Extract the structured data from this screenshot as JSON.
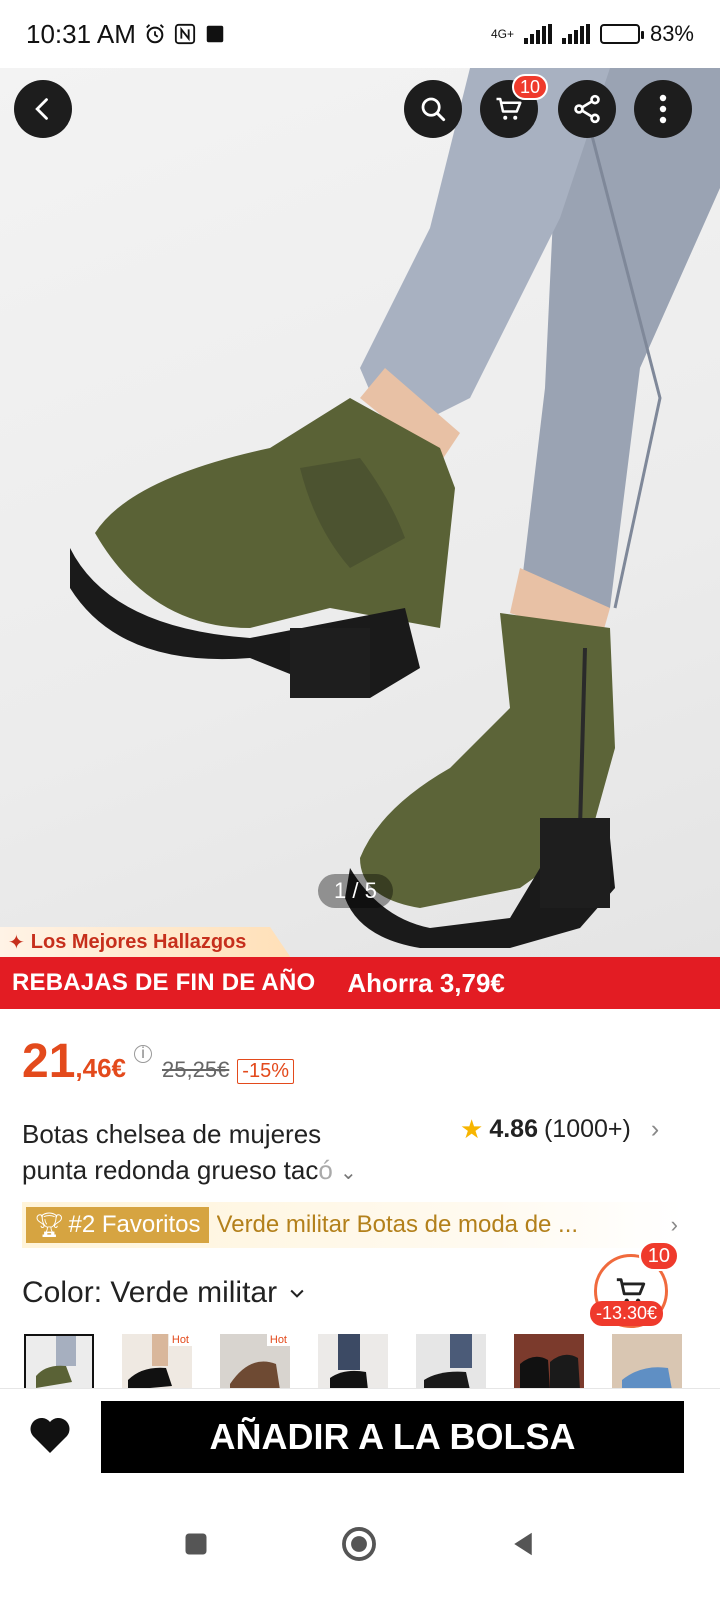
{
  "status_bar": {
    "time": "10:31 AM",
    "network": "4G+",
    "battery": "83%"
  },
  "header": {
    "cart_count": "10"
  },
  "gallery": {
    "page_indicator": "1 / 5"
  },
  "promo": {
    "top_label": "Los Mejores Hallazgos",
    "sale_label": "REBAJAS DE FIN DE AÑO",
    "savings_label": "Ahorra 3,79€"
  },
  "price": {
    "integer": "21",
    "decimal": ",46€",
    "original": "25,25€",
    "discount": "-15%"
  },
  "product": {
    "title_line1": "Botas chelsea de mujeres",
    "title_line2": "punta redonda grueso tac",
    "title_fade": "ó",
    "rating_value": "4.86",
    "rating_count": "(1000+)"
  },
  "ranking": {
    "badge": "#2 Favoritos",
    "text": "Verde militar Botas de moda de ..."
  },
  "floating_cart": {
    "count": "10",
    "discount": "-13.30€"
  },
  "color": {
    "label": "Color: Verde militar",
    "thumbnails": [
      {
        "selected": true,
        "hot": ""
      },
      {
        "selected": false,
        "hot": "Hot"
      },
      {
        "selected": false,
        "hot": "Hot"
      },
      {
        "selected": false,
        "hot": ""
      },
      {
        "selected": false,
        "hot": ""
      },
      {
        "selected": false,
        "hot": ""
      },
      {
        "selected": false,
        "hot": ""
      }
    ]
  },
  "actions": {
    "add_to_bag": "AÑADIR A LA BOLSA"
  },
  "colors": {
    "accent": "#e34a1c",
    "promo_red": "#e31c23",
    "boot_green": "#5a6236",
    "gold": "#d6a441"
  }
}
